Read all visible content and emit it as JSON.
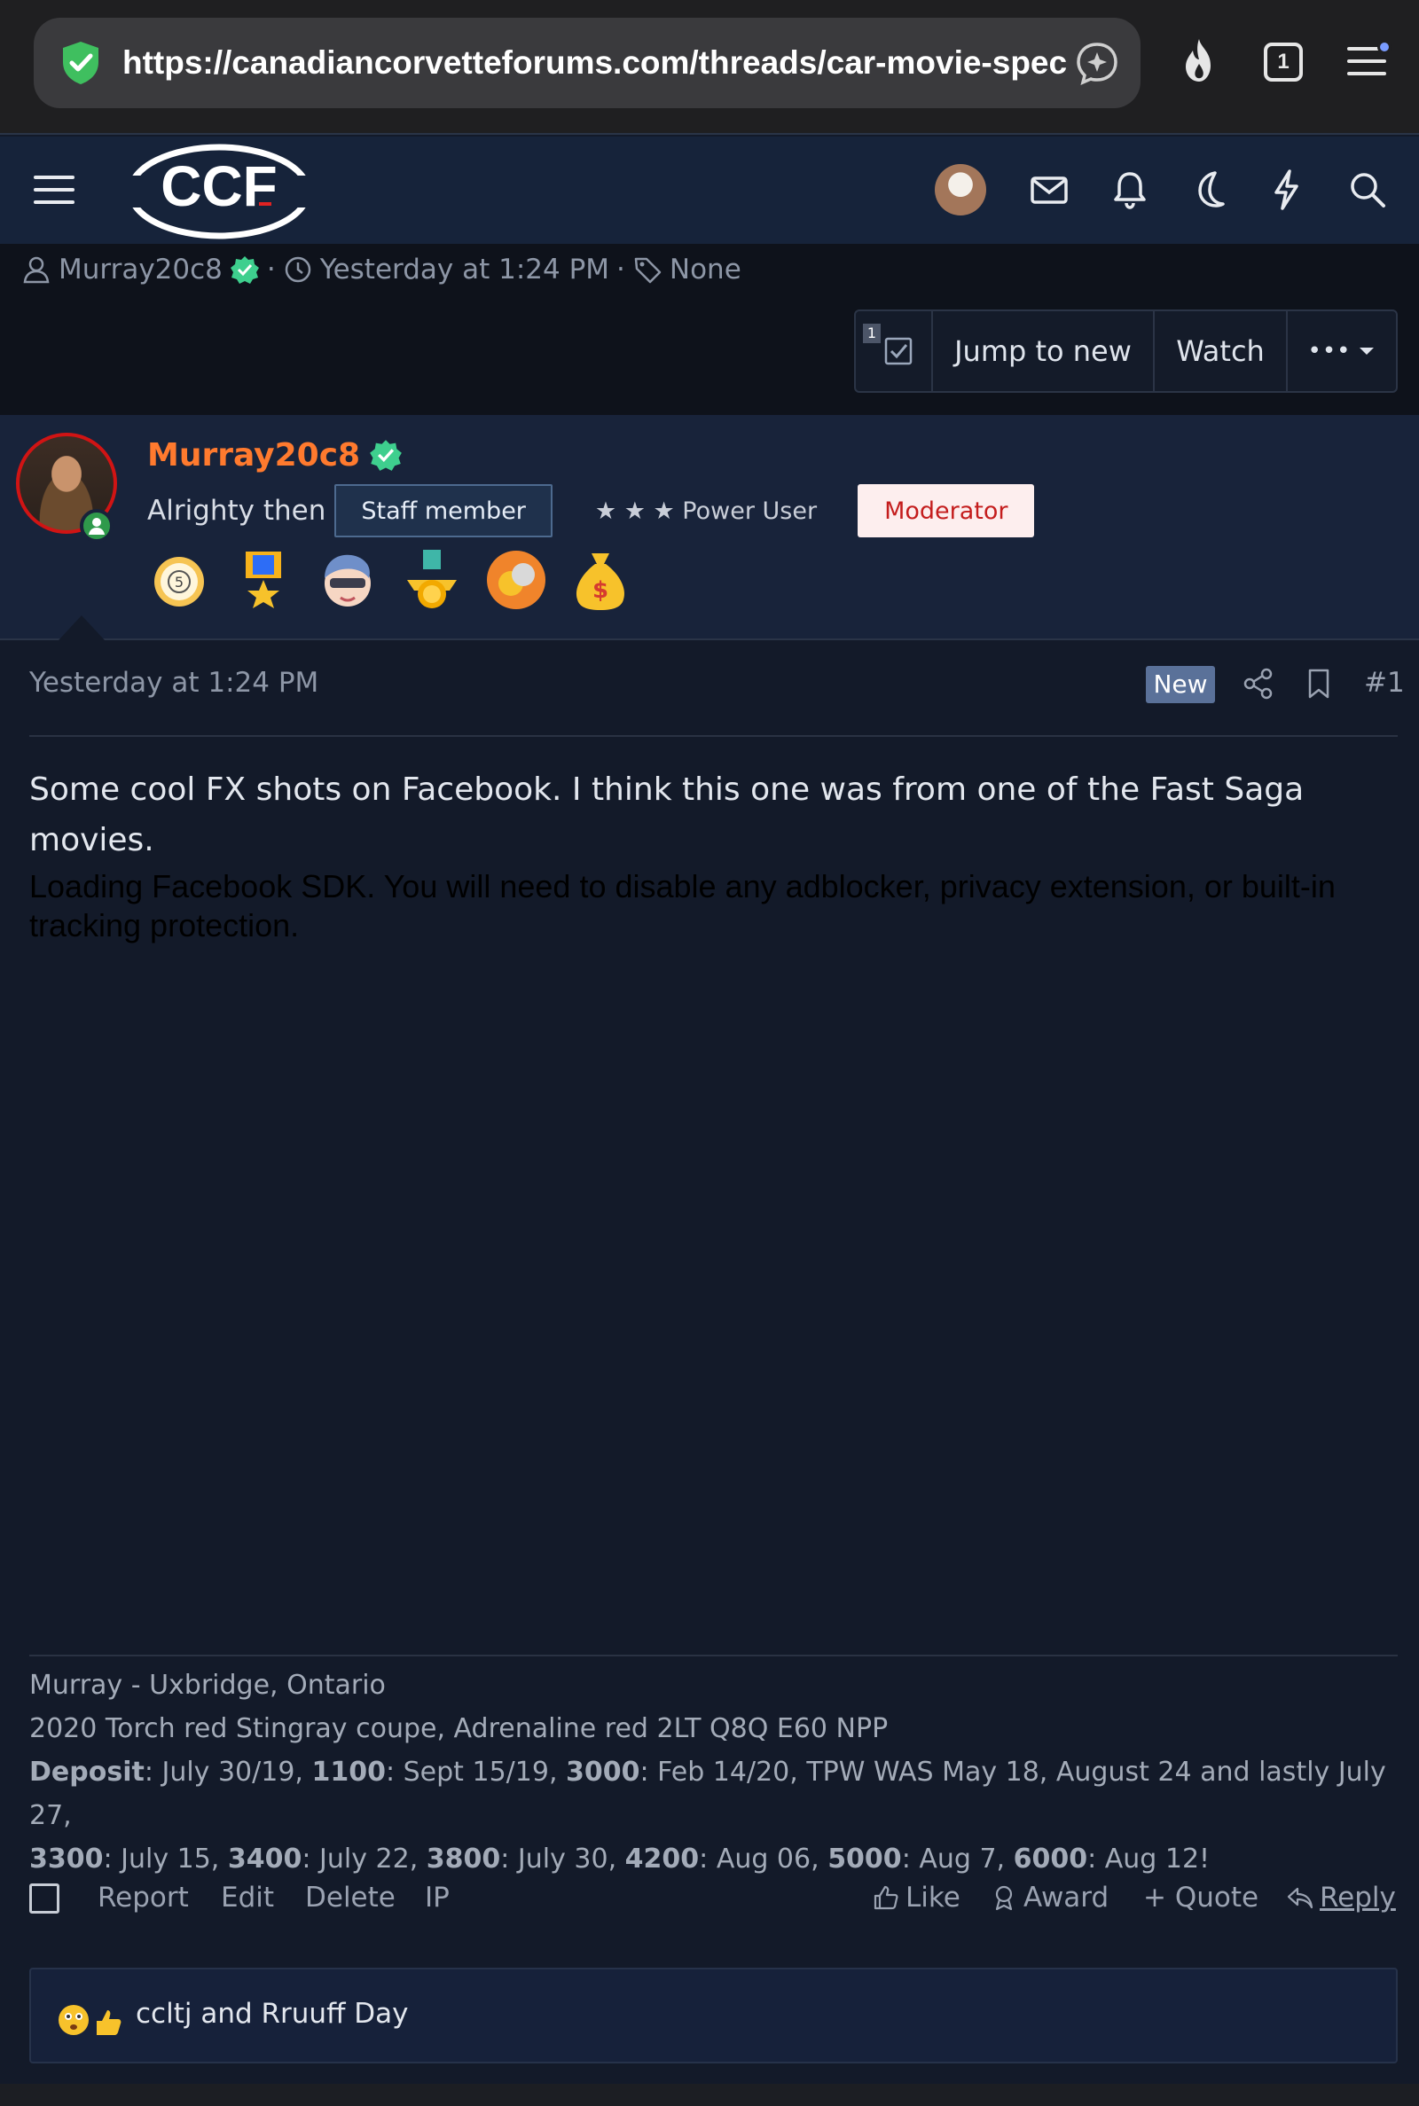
{
  "browser": {
    "url": "https://canadiancorvetteforums.com/threads/car-movie-spec",
    "tab_count": "1"
  },
  "header": {
    "logo_text": "CCF"
  },
  "thread_meta": {
    "author": "Murray20c8",
    "date": "Yesterday at 1:24 PM",
    "tags": "None",
    "separator": "·"
  },
  "thread_actions": {
    "selected_count": "1",
    "jump_label": "Jump to new",
    "watch_label": "Watch",
    "more_label": "•••"
  },
  "user": {
    "name": "Murray20c8",
    "title": "Alrighty then",
    "staff_badge": "Staff member",
    "stars": "★ ★ ★",
    "rank": "Power User",
    "mod_badge": "Moderator",
    "username_color": "#ff7a2e",
    "trophies": [
      "five-medal-icon",
      "star-ribbon-icon",
      "cool-guy-icon",
      "gold-medal-icon",
      "coin-icon",
      "money-bag-icon"
    ]
  },
  "post": {
    "time": "Yesterday at 1:24 PM",
    "new_badge": "New",
    "number": "#1",
    "body": "Some cool FX shots on Facebook. I think this one was from one of the Fast Saga movies.",
    "sdk_notice": "Loading Facebook SDK. You will need to disable any adblocker, privacy extension, or built-in tracking protection."
  },
  "signature": {
    "line1": "Murray - Uxbridge, Ontario",
    "line2": "2020 Torch red Stingray coupe, Adrenaline red 2LT Q8Q E60 NPP",
    "deposit_label": "Deposit",
    "deposit_text": ": July 30/19, ",
    "s1100": "1100",
    "s1100_text": ": Sept 15/19, ",
    "s3000": "3000",
    "s3000_text": ": Feb 14/20, TPW WAS May 18, August 24 and lastly July 27,",
    "s3300": "3300",
    "s3300_text": ": July 15, ",
    "s3400": "3400",
    "s3400_text": ": July 22, ",
    "s3800": "3800",
    "s3800_text": ": July 30, ",
    "s4200": "4200",
    "s4200_text": ": Aug 06, ",
    "s5000": "5000",
    "s5000_text": ": Aug 7, ",
    "s6000": "6000",
    "s6000_text": ": Aug 12!"
  },
  "post_actions": {
    "report": "Report",
    "edit": "Edit",
    "delete": "Delete",
    "ip": "IP",
    "like": "Like",
    "award": "Award",
    "quote": "+ Quote",
    "reply": "Reply"
  },
  "reactions": {
    "text": "ccltj and Rruuff Day"
  }
}
